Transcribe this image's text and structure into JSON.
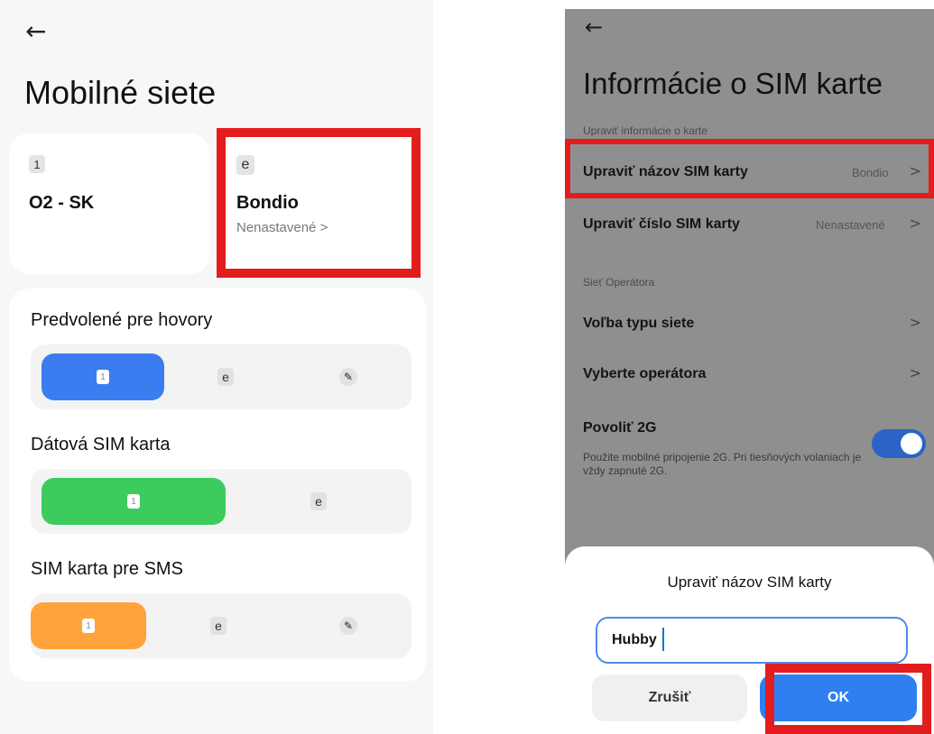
{
  "left": {
    "back_arrow": "←",
    "title": "Mobilné siete",
    "sims": [
      {
        "badge": "1",
        "name": "O2 - SK",
        "subtitle": ""
      },
      {
        "badge": "e",
        "name": "Bondio",
        "subtitle": "Nenastavené >"
      }
    ],
    "prefs": [
      {
        "label": "Predvolené pre hovory",
        "selected_color": "#3b7df0",
        "options": [
          "1",
          "e",
          "pen"
        ]
      },
      {
        "label": "Dátová SIM karta",
        "selected_color": "#3dcb5e",
        "options": [
          "1",
          "e"
        ]
      },
      {
        "label": "SIM karta pre SMS",
        "selected_color": "#ffa23c",
        "options": [
          "1",
          "e",
          "pen"
        ]
      }
    ]
  },
  "right": {
    "back_arrow": "←",
    "title": "Informácie o SIM karte",
    "section1": "Upraviť informácie o karte",
    "rows": [
      {
        "label": "Upraviť názov SIM karty",
        "value": "Bondio",
        "chevron": ">"
      },
      {
        "label": "Upraviť číslo SIM karty",
        "value": "Nenastavené",
        "chevron": ">"
      }
    ],
    "section2": "Sieť Operátora",
    "rows2": [
      {
        "label": "Voľba typu siete",
        "chevron": ">"
      },
      {
        "label": "Vyberte operátora",
        "chevron": ">"
      }
    ],
    "toggle_row": {
      "label": "Povoliť 2G",
      "description": "Použite mobilné pripojenie 2G. Pri tiesňových volaniach je vždy zapnuté 2G.",
      "enabled": true
    },
    "dialog": {
      "title": "Upraviť názov SIM karty",
      "input_value": "Hubby",
      "cancel": "Zrušiť",
      "ok": "OK"
    }
  },
  "colors": {
    "highlight": "#e31d1d",
    "accent_blue": "#2f7ff0",
    "green": "#3dcb5e",
    "orange": "#ffa23c"
  }
}
